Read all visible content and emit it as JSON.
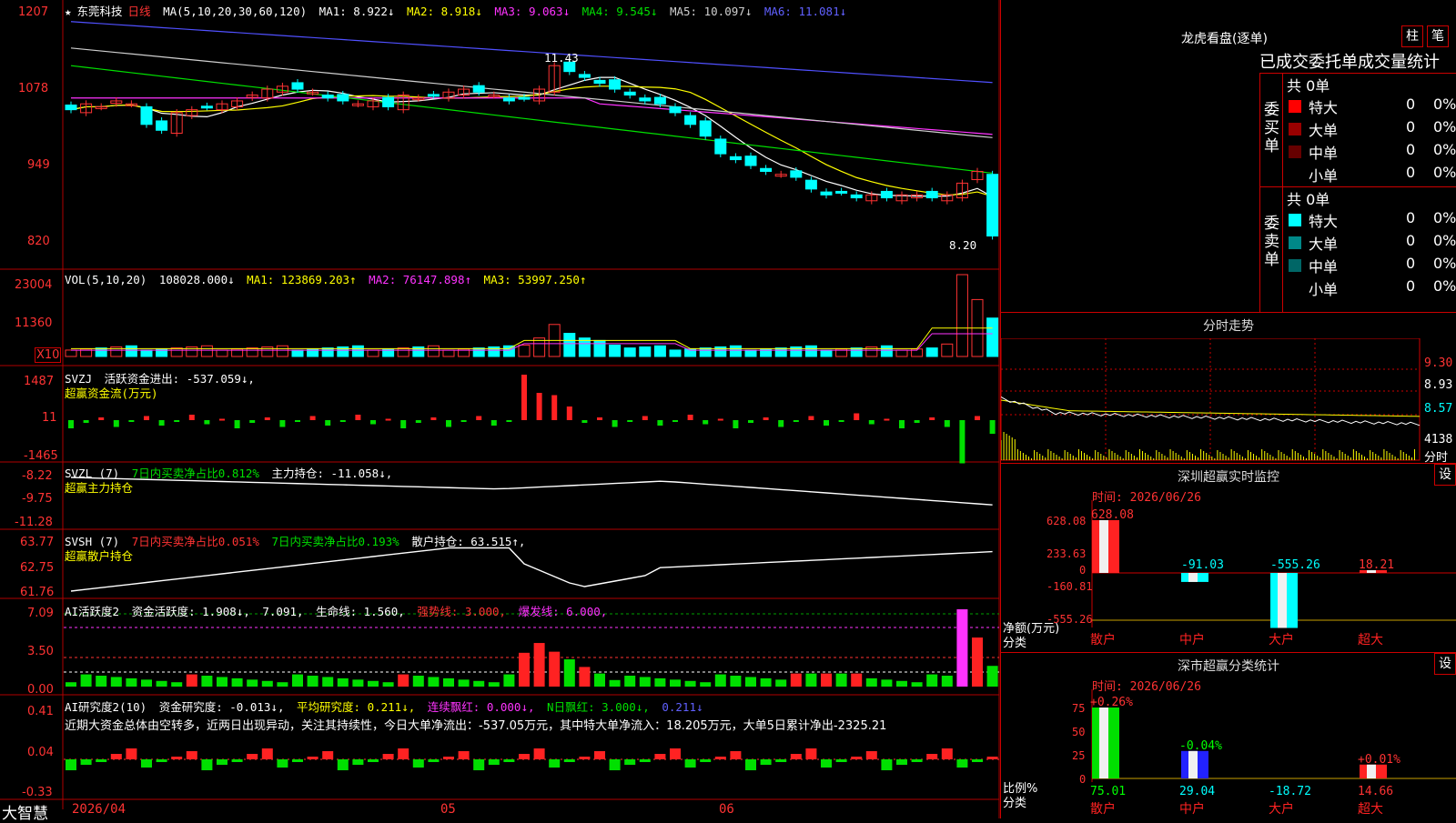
{
  "app": {
    "brand": "大智慧"
  },
  "stock": {
    "star": "★",
    "name": "东莞科技",
    "period": "日线"
  },
  "main_header": {
    "ma_label": "MA(5,10,20,30,60,120)",
    "items": [
      {
        "text": "MA1: 8.922↓",
        "color": "#ffffff"
      },
      {
        "text": "MA2: 8.918↓",
        "color": "#ffff00"
      },
      {
        "text": "MA3: 9.063↓",
        "color": "#ff33ff"
      },
      {
        "text": "MA4: 9.545↓",
        "color": "#00e000"
      },
      {
        "text": "MA5: 10.097↓",
        "color": "#cfcfcf"
      },
      {
        "text": "MA6: 11.081↓",
        "color": "#5050ff"
      }
    ]
  },
  "price_axis": [
    "1207",
    "1078",
    "949",
    "820"
  ],
  "price_marks": {
    "high": "11.43",
    "low": "8.20"
  },
  "vol_header": {
    "label": "VOL(5,10,20)",
    "value": "108028.000↓",
    "ma1": "MA1: 123869.203↑",
    "ma2": "MA2: 76147.898↑",
    "ma3": "MA3: 53997.250↑"
  },
  "vol_axis": [
    "23004",
    "11360"
  ],
  "vol_unit": "X10",
  "svzj": {
    "label": "SVZJ",
    "text": "活跃资金进出: -537.059↓,",
    "subtitle": "超赢资金流(万元)",
    "axis": [
      "1487",
      "11",
      "-1465"
    ]
  },
  "svzl": {
    "label": "SVZL (7)",
    "text1": "7日内买卖净占比0.812%",
    "text2": "主力持仓: -11.058↓,",
    "subtitle": "超赢主力持仓",
    "axis": [
      "-8.22",
      "-9.75",
      "-11.28"
    ]
  },
  "svsh": {
    "label": "SVSH (7)",
    "text1": "7日内买卖净占比0.051%",
    "text2": "7日内买卖净占比0.193%",
    "text3": "散户持仓: 63.515↑,",
    "subtitle": "超赢散户持仓",
    "axis": [
      "63.77",
      "62.75",
      "61.76"
    ]
  },
  "ai1": {
    "label": "AI活跃度2",
    "t1": "资金活跃度: 1.908↓,",
    "t2": "7.091,",
    "t3": "生命线: 1.560,",
    "t4": "强势线: 3.000,",
    "t5": "爆发线: 6.000,",
    "axis": [
      "7.09",
      "3.50",
      "0.00"
    ]
  },
  "ai2": {
    "label": "AI研究度2(10)",
    "t1": "资金研究度: -0.013↓,",
    "t2": "平均研究度: 0.211↓,",
    "t3": "连续飘红: 0.000↓,",
    "t4": "N日飘红: 3.000↓,",
    "t5": "0.211↓",
    "comment": "近期大资金总体由空转多，近两日出现异动，关注其持续性，今日大单净流出：-537.05万元，其中特大单净流入：18.205万元，大单5日累计净出-2325.21",
    "axis": [
      "0.41",
      "0.04",
      "-0.33"
    ]
  },
  "date_axis": [
    "2026/04",
    "05",
    "06"
  ],
  "dragon": {
    "title": "龙虎看盘(逐单)",
    "tab1": "柱",
    "tab2": "笔",
    "heading": "已成交委托单成交量统计",
    "buy_group": "委买单",
    "sell_group": "委卖单",
    "buy_total": "共 0单",
    "sell_total": "共 0单",
    "buy_rows": [
      {
        "name": "特大",
        "count": "0",
        "pct": "0%",
        "color": "#ff0000"
      },
      {
        "name": "大单",
        "count": "0",
        "pct": "0%",
        "color": "#990000"
      },
      {
        "name": "中单",
        "count": "0",
        "pct": "0%",
        "color": "#660000"
      },
      {
        "name": "小单",
        "count": "0",
        "pct": "0%",
        "color": "#000000"
      }
    ],
    "sell_rows": [
      {
        "name": "特大",
        "count": "0",
        "pct": "0%",
        "color": "#00ffff"
      },
      {
        "name": "大单",
        "count": "0",
        "pct": "0%",
        "color": "#008888"
      },
      {
        "name": "中单",
        "count": "0",
        "pct": "0%",
        "color": "#006666"
      },
      {
        "name": "小单",
        "count": "0",
        "pct": "0%",
        "color": "#000000"
      }
    ]
  },
  "intraday": {
    "title": "分时走势",
    "axis": [
      "9.30",
      "8.93",
      "8.57",
      "4138",
      "分时"
    ]
  },
  "sz_monitor": {
    "title": "深圳超赢实时监控",
    "set": "设",
    "date": "时间: 2026/06/26",
    "axis": [
      "628.08",
      "233.63",
      "0",
      "-160.81",
      "-555.26"
    ],
    "net_label": "净额(万元)",
    "cat_label": "分类",
    "bars": [
      {
        "cat": "散户",
        "value": 628.08,
        "label": "628.08",
        "color": "#ff2222"
      },
      {
        "cat": "中户",
        "value": -91.03,
        "label": "-91.03",
        "color": "#00ffff"
      },
      {
        "cat": "大户",
        "value": -555.26,
        "label": "-555.26",
        "color": "#00ffff"
      },
      {
        "cat": "超大",
        "value": 18.21,
        "label": "18.21",
        "color": "#ff2222"
      }
    ]
  },
  "sz_class": {
    "title": "深市超赢分类统计",
    "set": "设",
    "date": "时间: 2026/06/26",
    "axis": [
      "75",
      "50",
      "25",
      "0"
    ],
    "ratio_label": "比例%",
    "cat_label": "分类",
    "bars": [
      {
        "cat": "散户",
        "value": 75.01,
        "top": "+0.26%",
        "bottom": "75.01",
        "color": "#00e000"
      },
      {
        "cat": "中户",
        "value": 29.04,
        "top": "-0.04%",
        "bottom": "29.04",
        "color": "#2222ff"
      },
      {
        "cat": "大户",
        "value": -18.72,
        "top": "",
        "bottom": "-18.72",
        "color": "#00ffff"
      },
      {
        "cat": "超大",
        "value": 14.66,
        "top": "+0.01%",
        "bottom": "14.66",
        "color": "#ff2222"
      }
    ]
  },
  "colors": {
    "up": "#ff3333",
    "down": "#00ffff",
    "grid": "#b00000",
    "pos": "#ff2222",
    "neg": "#00e000"
  }
}
